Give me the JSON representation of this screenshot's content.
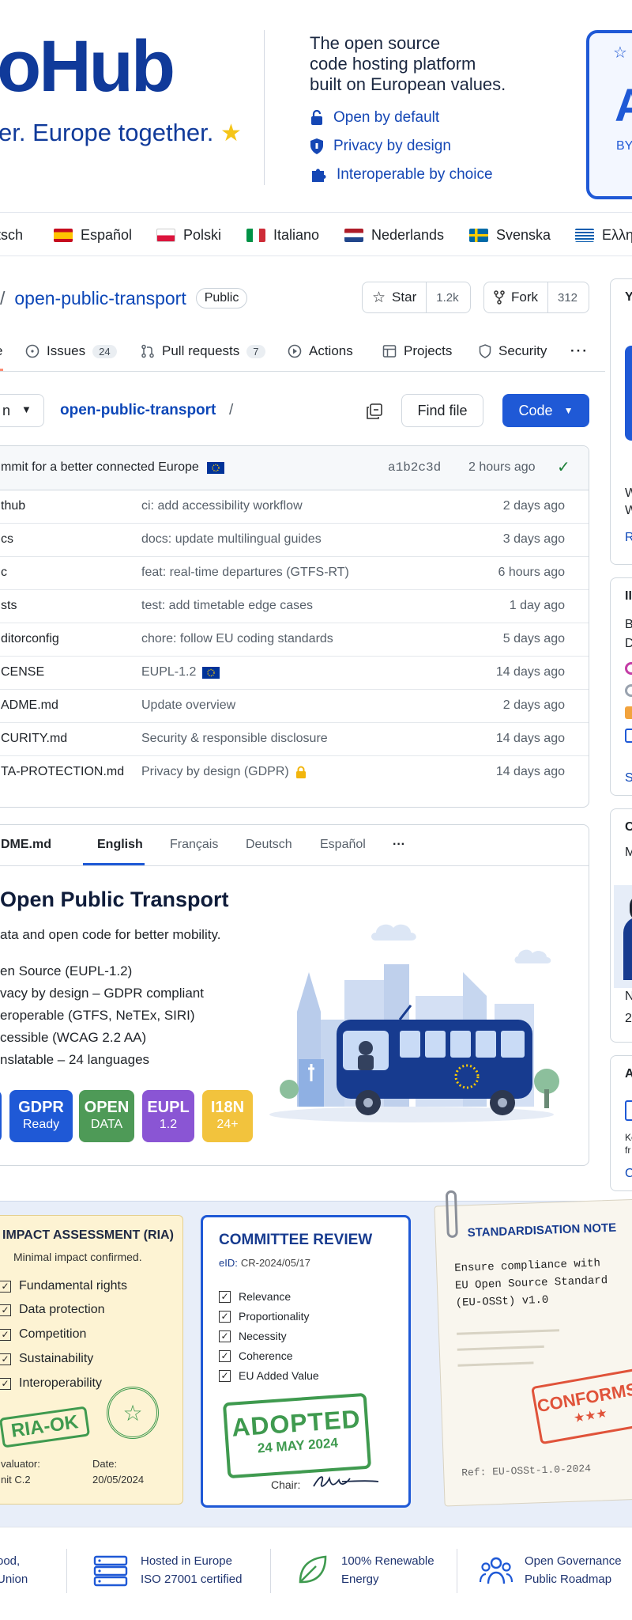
{
  "hero": {
    "logo_text": "oHub",
    "tagline": "er. Europe together.",
    "intro_lines": [
      "The open source",
      "code hosting platform",
      "built on European values."
    ],
    "features": [
      {
        "label": "Open by default",
        "icon": "lock-icon"
      },
      {
        "label": "Privacy by design",
        "icon": "shield-icon"
      },
      {
        "label": "Interoperable by choice",
        "icon": "puzzle-icon"
      }
    ],
    "badge_letter": "A",
    "badge_caption": "BY"
  },
  "languages": [
    "tsch",
    "Español",
    "Polski",
    "Italiano",
    "Nederlands",
    "Svenska",
    "Ελλη"
  ],
  "repo": {
    "slash": "/",
    "name": "open-public-transport",
    "visibility": "Public",
    "star_label": "Star",
    "star_count": "1.2k",
    "fork_label": "Fork",
    "fork_count": "312"
  },
  "tabs": [
    {
      "label": "e",
      "count": ""
    },
    {
      "label": "Issues",
      "count": "24"
    },
    {
      "label": "Pull requests",
      "count": "7"
    },
    {
      "label": "Actions",
      "count": ""
    },
    {
      "label": "Projects",
      "count": ""
    },
    {
      "label": "Security",
      "count": ""
    }
  ],
  "toolbar": {
    "branch": "n",
    "path": "open-public-transport",
    "path_sep": "/",
    "find_file": "Find file",
    "code": "Code"
  },
  "latest_commit": {
    "message": "mmit for a better connected Europe",
    "hash": "a1b2c3d",
    "time": "2 hours ago"
  },
  "files": [
    {
      "name": "thub",
      "message": "ci: add accessibility workflow",
      "date": "2 days ago"
    },
    {
      "name": "cs",
      "message": "docs: update multilingual guides",
      "date": "3 days ago"
    },
    {
      "name": "c",
      "message": "feat: real-time departures (GTFS-RT)",
      "date": "6 hours ago"
    },
    {
      "name": "sts",
      "message": "test: add timetable edge cases",
      "date": "1 day ago"
    },
    {
      "name": "ditorconfig",
      "message": "chore: follow EU coding standards",
      "date": "5 days ago"
    },
    {
      "name": "CENSE",
      "message": "EUPL-1.2",
      "date": "14 days ago"
    },
    {
      "name": "ADME.md",
      "message": "Update overview",
      "date": "2 days ago"
    },
    {
      "name": "CURITY.md",
      "message": "Security & responsible disclosure",
      "date": "14 days ago"
    },
    {
      "name": "TA-PROTECTION.md",
      "message": "Privacy by design (GDPR)",
      "date": "14 days ago"
    }
  ],
  "readme": {
    "file": "DME.md",
    "langs": [
      "English",
      "Français",
      "Deutsch",
      "Español"
    ],
    "more": "···",
    "title": "Open Public Transport",
    "subtitle": "ata and open code for better mobility.",
    "bullets": [
      "en Source (EUPL-1.2)",
      "vacy by design – GDPR compliant",
      "eroperable (GTFS, NeTEx, SIRI)",
      "cessible (WCAG 2.2 AA)",
      "nslatable – 24 languages"
    ],
    "tags": [
      {
        "l1": "GDPR",
        "l2": "Ready",
        "color": "#1f59d6"
      },
      {
        "l1": "OPEN",
        "l2": "DATA",
        "color": "#4e9a57"
      },
      {
        "l1": "EUPL",
        "l2": "1.2",
        "color": "#8a55d4"
      },
      {
        "l1": "I18N",
        "l2": "24+",
        "color": "#f2c33d"
      }
    ]
  },
  "sidebar": {
    "card1": {
      "head": "Y",
      "lines": [
        "W",
        "W",
        "R"
      ]
    },
    "card2": {
      "head": "II",
      "lines": [
        "B",
        "D",
        "S"
      ]
    },
    "card3": {
      "head": "C",
      "lines": [
        "M",
        "N",
        "2"
      ]
    },
    "card4": {
      "head": "A",
      "lines": [
        "Ke",
        "fr",
        "C"
      ]
    }
  },
  "ria": {
    "title": "IMPACT ASSESSMENT (RIA)",
    "subtitle": "Minimal impact confirmed.",
    "items": [
      "Fundamental rights",
      "Data protection",
      "Competition",
      "Sustainability",
      "Interoperability"
    ],
    "stamp": "RIA-OK",
    "evaluator_label": "valuator:",
    "evaluator": "nit C.2",
    "date_label": "Date:",
    "date": "20/05/2024"
  },
  "committee": {
    "title": "COMMITTEE REVIEW",
    "id_label": "eID:",
    "id": "CR-2024/05/17",
    "items": [
      "Relevance",
      "Proportionality",
      "Necessity",
      "Coherence",
      "EU Added Value"
    ],
    "stamp": "ADOPTED",
    "stamp_date": "24 MAY 2024",
    "chair_label": "Chair:"
  },
  "standard": {
    "title": "STANDARDISATION NOTE",
    "body": [
      "Ensure compliance with",
      "EU Open Source Standard",
      "(EU-OSSt) v1.0"
    ],
    "stamp": "CONFORMS",
    "stamp_stars": "★★★",
    "ref": "Ref: EU-OSSt-1.0-2024"
  },
  "footer": [
    {
      "l1": "ood,",
      "l2": "Union",
      "icon": ""
    },
    {
      "l1": "Hosted in Europe",
      "l2": "ISO 27001 certified",
      "icon": "server-icon"
    },
    {
      "l1": "100% Renewable",
      "l2": "Energy",
      "icon": "leaf-icon"
    },
    {
      "l1": "Open Governance",
      "l2": "Public Roadmap",
      "icon": "people-icon"
    }
  ]
}
